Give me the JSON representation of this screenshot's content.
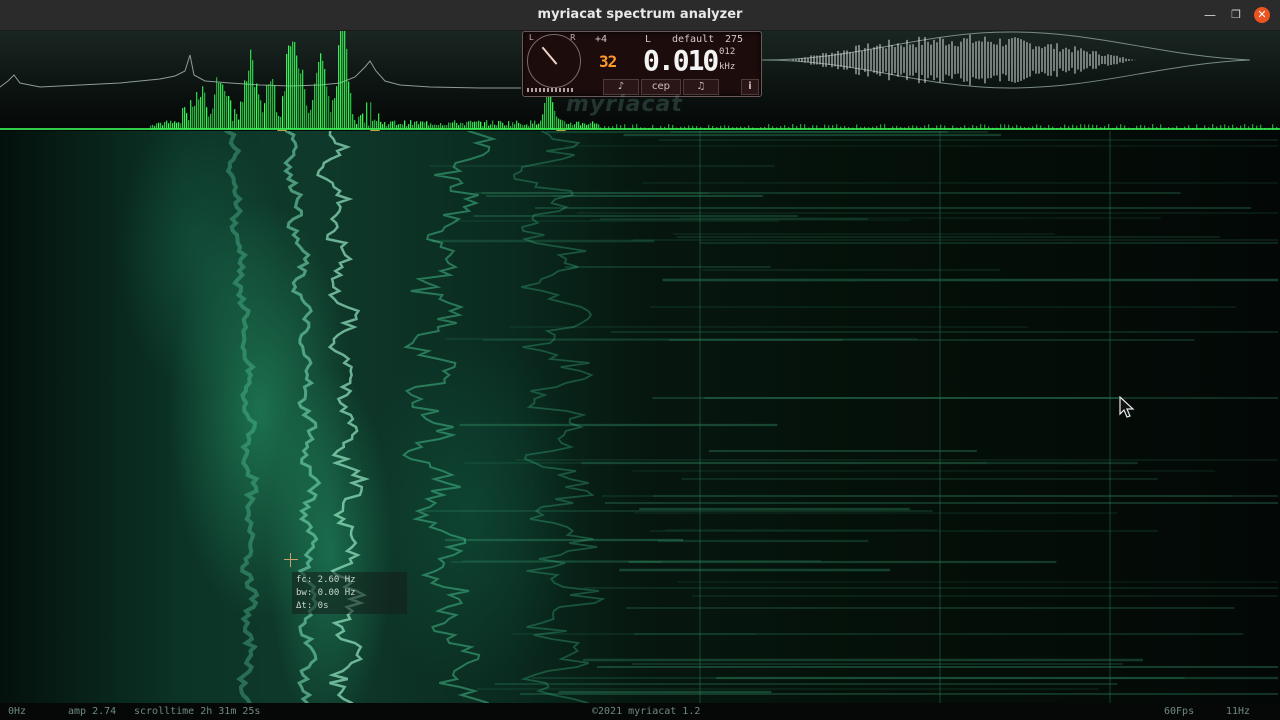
{
  "window": {
    "title": "myriacat spectrum analyzer"
  },
  "panel": {
    "channel_left": "L",
    "channel_right": "R",
    "gain": "+4",
    "channel": "L",
    "preset": "default",
    "count": "275",
    "small_value": "32",
    "big_value": "0.010",
    "sub_value": "012",
    "unit": "kHz",
    "buttons": [
      "cep"
    ],
    "info_label": "i"
  },
  "watermark": "myriacat",
  "readout": {
    "frequency": "fc: 2.60 Hz",
    "bandwidth": "bw: 0.00 Hz",
    "delta_time": "Δt: 0s"
  },
  "status": {
    "min_freq": "0Hz",
    "amp": "amp 2.74",
    "scrolltime": "scrolltime 2h 31m 25s",
    "copyright": "©2021 myriacat 1.2",
    "fps": "60Fps",
    "max_freq": "11Hz"
  },
  "colors": {
    "accent_green": "#3cff5a",
    "panel_bg": "#1d0c0c",
    "lcd_orange": "#ff9a2a",
    "close_button": "#e95420"
  },
  "icons": {
    "minimize": "minimize-icon",
    "maximize": "maximize-icon",
    "close": "close-icon",
    "tuning_fork": "tuning-fork-icon",
    "music_note": "music-note-icon",
    "cursor": "mouse-cursor-icon"
  }
}
